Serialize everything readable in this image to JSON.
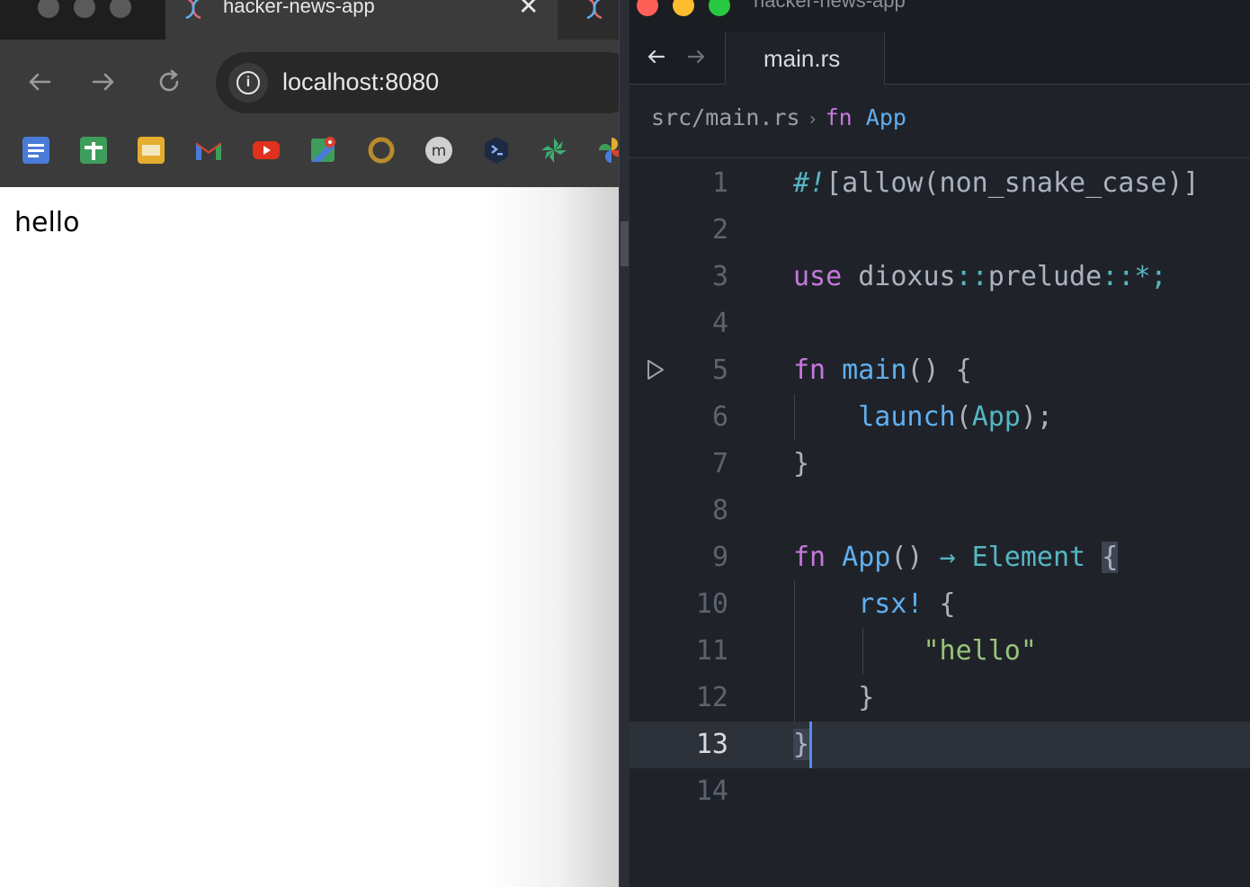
{
  "browser": {
    "tab_title": "hacker-news-app",
    "tab_close": "✕",
    "url": "localhost:8080",
    "page_text": "hello",
    "bookmarks": [
      "docs",
      "sheets",
      "slides",
      "gmail",
      "youtube",
      "maps",
      "circle",
      "m",
      "shell",
      "pinwheel",
      "photos"
    ]
  },
  "editor": {
    "window_title": "hacker-news-app",
    "tab_label": "main.rs",
    "breadcrumb": {
      "path": "src/main.rs",
      "separator": "›",
      "keyword": "fn",
      "symbol": "App"
    },
    "lines": [
      {
        "n": "1"
      },
      {
        "n": "2"
      },
      {
        "n": "3"
      },
      {
        "n": "4"
      },
      {
        "n": "5"
      },
      {
        "n": "6"
      },
      {
        "n": "7"
      },
      {
        "n": "8"
      },
      {
        "n": "9"
      },
      {
        "n": "10"
      },
      {
        "n": "11"
      },
      {
        "n": "12"
      },
      {
        "n": "13"
      },
      {
        "n": "14"
      }
    ],
    "code": {
      "l1_hash": "#!",
      "l1_rest": "[allow(non_snake_case)]",
      "l3_use": "use",
      "l3_path": " dioxus",
      "l3_sep1": "::",
      "l3_prelude": "prelude",
      "l3_sep2": "::",
      "l3_star": "*;",
      "l5_fn": "fn",
      "l5_name": " main",
      "l5_rest": "() {",
      "l6_indent": "    ",
      "l6_call": "launch",
      "l6_open": "(",
      "l6_arg": "App",
      "l6_close": ");",
      "l7_close": "}",
      "l9_fn": "fn",
      "l9_name": " App",
      "l9_parens": "() ",
      "l9_arrow": "→",
      "l9_type": " Element ",
      "l9_brace": "{",
      "l10_indent": "    ",
      "l10_macro": "rsx!",
      "l10_brace": " {",
      "l11_indent": "        ",
      "l11_str": "\"hello\"",
      "l12_indent": "    ",
      "l12_close": "}",
      "l13_close": "}"
    },
    "current_line": "13",
    "colors": {
      "keyword": "#c678dd",
      "function": "#61afef",
      "type": "#56b6c2",
      "string": "#98c379",
      "background": "#1f2329"
    }
  }
}
